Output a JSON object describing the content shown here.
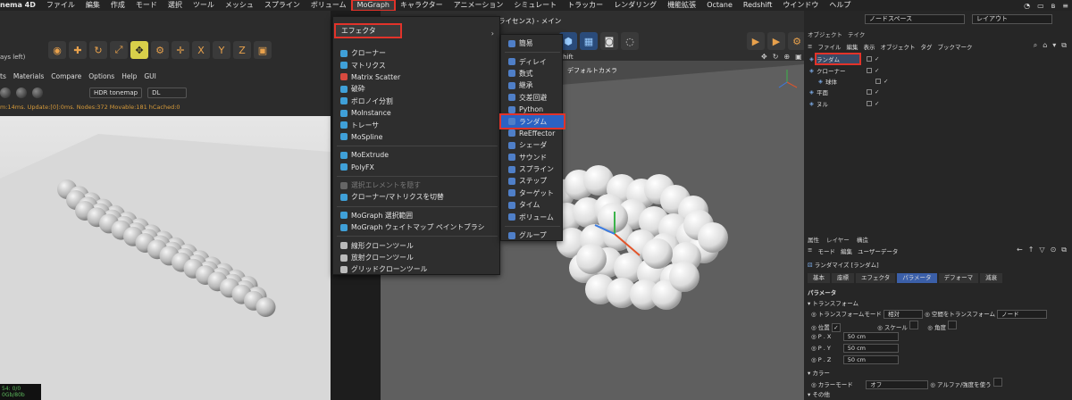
{
  "menubar": {
    "app": "nema 4D",
    "items": [
      "ファイル",
      "編集",
      "作成",
      "モード",
      "選択",
      "ツール",
      "メッシュ",
      "スプライン",
      "ボリューム",
      "MoGraph",
      "キャラクター",
      "アニメーション",
      "シミュレート",
      "トラッカー",
      "レンダリング",
      "機能拡張",
      "Octane",
      "Redshift",
      "ウインドウ",
      "ヘルプ"
    ],
    "selected_index": 9
  },
  "left_view": {
    "title": "ays left)",
    "menu": [
      "ts",
      "Materials",
      "Compare",
      "Options",
      "Help",
      "GUI"
    ],
    "tonemap": "HDR tonemap",
    "dl": "DL",
    "status": "m:14ms. Update:[0]:0ms. Nodes:372 Movable:181 hCached:0",
    "corner_line1": "54: 0/0",
    "corner_line2": "0Gb/80b"
  },
  "mid_view": {
    "title": "ore 向け非商用ライセンス) - メイン",
    "redshift": "dshift",
    "camera": "デフォルトカメラ"
  },
  "mograph_menu": {
    "header": "エフェクタ",
    "items": [
      {
        "label": "クローナー",
        "icon": "cloner-icon",
        "color": "#3fa0d8"
      },
      {
        "label": "マトリクス",
        "icon": "matrix-icon",
        "color": "#3fa0d8"
      },
      {
        "label": "Matrix Scatter",
        "icon": "matrix-scatter-icon",
        "color": "#d84a3f"
      },
      {
        "label": "破砕",
        "icon": "fracture-icon",
        "color": "#3fa0d8"
      },
      {
        "label": "ボロノイ分割",
        "icon": "voronoi-icon",
        "color": "#3fa0d8"
      },
      {
        "label": "MoInstance",
        "icon": "moinstance-icon",
        "color": "#3fa0d8"
      },
      {
        "label": "トレーサ",
        "icon": "tracer-icon",
        "color": "#3fa0d8"
      },
      {
        "label": "MoSpline",
        "icon": "mospline-icon",
        "color": "#3fa0d8"
      },
      {
        "sep": true
      },
      {
        "label": "MoExtrude",
        "icon": "moextrude-icon",
        "color": "#3fa0d8"
      },
      {
        "label": "PolyFX",
        "icon": "polyfx-icon",
        "color": "#3fa0d8"
      },
      {
        "sep": true
      },
      {
        "label": "選択エレメントを隠す",
        "icon": "hide-selection-icon",
        "color": "#666",
        "disabled": true
      },
      {
        "label": "クローナー/マトリクスを切替",
        "icon": "toggle-cloner-icon",
        "color": "#3fa0d8"
      },
      {
        "sep": true
      },
      {
        "label": "MoGraph 選択範囲",
        "icon": "mograph-selection-icon",
        "color": "#3fa0d8"
      },
      {
        "label": "MoGraph ウェイトマップ ペイントブラシ",
        "icon": "weightmap-brush-icon",
        "color": "#3fa0d8"
      },
      {
        "sep": true
      },
      {
        "label": "線形クローンツール",
        "icon": "linear-clone-icon",
        "color": "#bbb"
      },
      {
        "label": "放射クローンツール",
        "icon": "radial-clone-icon",
        "color": "#bbb"
      },
      {
        "label": "グリッドクローンツール",
        "icon": "grid-clone-icon",
        "color": "#bbb"
      }
    ]
  },
  "effector_menu": {
    "items": [
      {
        "label": "簡易",
        "icon": "plain-effector-icon"
      },
      {
        "sep": true
      },
      {
        "label": "ディレイ",
        "icon": "delay-effector-icon"
      },
      {
        "label": "数式",
        "icon": "formula-effector-icon"
      },
      {
        "label": "継承",
        "icon": "inheritance-effector-icon"
      },
      {
        "label": "交差回避",
        "icon": "push-apart-effector-icon"
      },
      {
        "label": "Python",
        "icon": "python-effector-icon"
      },
      {
        "label": "ランダム",
        "icon": "random-effector-icon",
        "active": true
      },
      {
        "label": "ReEffector",
        "icon": "reeffector-icon"
      },
      {
        "label": "シェーダ",
        "icon": "shader-effector-icon"
      },
      {
        "label": "サウンド",
        "icon": "sound-effector-icon"
      },
      {
        "label": "スプライン",
        "icon": "spline-effector-icon"
      },
      {
        "label": "ステップ",
        "icon": "step-effector-icon"
      },
      {
        "label": "ターゲット",
        "icon": "target-effector-icon"
      },
      {
        "label": "タイム",
        "icon": "time-effector-icon"
      },
      {
        "label": "ボリューム",
        "icon": "volume-effector-icon"
      },
      {
        "sep": true
      },
      {
        "label": "グループ",
        "icon": "group-effector-icon"
      }
    ]
  },
  "right_panel": {
    "node_space": "ノードスペース",
    "layout": "レイアウト",
    "tabs": [
      "オブジェクト",
      "テイク"
    ],
    "menu": [
      "ファイル",
      "編集",
      "表示",
      "オブジェクト",
      "タグ",
      "ブックマーク"
    ],
    "objects": [
      {
        "name": "ランダム",
        "indent": 0,
        "selected": true
      },
      {
        "name": "クローナー",
        "indent": 0
      },
      {
        "name": "球体",
        "indent": 1
      },
      {
        "name": "平面",
        "indent": 0
      },
      {
        "name": "ヌル",
        "indent": 0
      }
    ],
    "attr_tabs": [
      "属性",
      "レイヤー",
      "構造"
    ],
    "attr_menu": [
      "モード",
      "編集",
      "ユーザーデータ"
    ],
    "attr_object": "ランダマイズ [ランダム]",
    "attr_subtabs": [
      "基本",
      "座標",
      "エフェクタ",
      "パラメータ",
      "デフォーマ",
      "減衰"
    ],
    "attr_subtab_active": 3,
    "param_title": "パラメータ",
    "transform_section": "トランスフォーム",
    "transform_mode_label": "トランスフォームモード",
    "transform_mode_value": "相対",
    "transform_space_label": "空間をトランスフォーム",
    "transform_space_value": "ノード",
    "position_label": "位置",
    "scale_label": "スケール",
    "angle_label": "角度",
    "px_label": "P . X",
    "px_value": "50 cm",
    "py_label": "P . Y",
    "py_value": "50 cm",
    "pz_label": "P . Z",
    "pz_value": "50 cm",
    "color_section": "カラー",
    "color_mode_label": "カラーモード",
    "color_mode_value": "オフ",
    "alpha_label": "アルファ/強度を使う",
    "other_section": "その他"
  }
}
